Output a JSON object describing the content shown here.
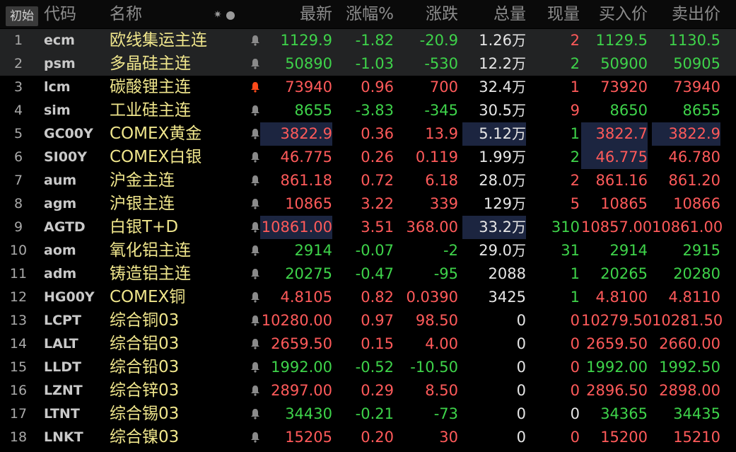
{
  "header": {
    "init_label": "初始",
    "code": "代码",
    "name": "名称",
    "last": "最新",
    "pct": "涨幅%",
    "change": "涨跌",
    "volume": "总量",
    "current": "现量",
    "bid": "买入价",
    "ask": "卖出价"
  },
  "colors": {
    "up": "#ff5a5a",
    "down": "#3ed34a",
    "name": "#f0e68c",
    "highlight": "#1c2540",
    "selected_row": "#222324"
  },
  "rows": [
    {
      "num": "1",
      "code": "ecm",
      "name": "欧线集运主连",
      "alert": false,
      "last": "1129.9",
      "pct": "-1.82",
      "chg": "-20.9",
      "vol": "1.26",
      "vol_unit": "万",
      "cur": "2",
      "bid": "1129.5",
      "ask": "1130.5",
      "dir": "dn",
      "cur_dir": "up",
      "bid_dir": "dn",
      "ask_dir": "dn"
    },
    {
      "num": "2",
      "code": "psm",
      "name": "多晶硅主连",
      "alert": false,
      "last": "50890",
      "pct": "-1.03",
      "chg": "-530",
      "vol": "12.2",
      "vol_unit": "万",
      "cur": "2",
      "bid": "50900",
      "ask": "50905",
      "dir": "dn",
      "cur_dir": "dn",
      "bid_dir": "dn",
      "ask_dir": "dn"
    },
    {
      "num": "3",
      "code": "lcm",
      "name": "碳酸锂主连",
      "alert": true,
      "last": "73940",
      "pct": "0.96",
      "chg": "700",
      "vol": "32.4",
      "vol_unit": "万",
      "cur": "1",
      "bid": "73920",
      "ask": "73940",
      "dir": "up",
      "cur_dir": "up",
      "bid_dir": "up",
      "ask_dir": "up"
    },
    {
      "num": "4",
      "code": "sim",
      "name": "工业硅主连",
      "alert": false,
      "last": "8655",
      "pct": "-3.83",
      "chg": "-345",
      "vol": "30.5",
      "vol_unit": "万",
      "cur": "9",
      "bid": "8650",
      "ask": "8655",
      "dir": "dn",
      "cur_dir": "up",
      "bid_dir": "dn",
      "ask_dir": "dn"
    },
    {
      "num": "5",
      "code": "GC00Y",
      "name": "COMEX黄金",
      "alert": false,
      "last": "3822.9",
      "pct": "0.36",
      "chg": "13.9",
      "vol": "5.12",
      "vol_unit": "万",
      "cur": "1",
      "bid": "3822.7",
      "ask": "3822.9",
      "dir": "up",
      "cur_dir": "dn",
      "bid_dir": "up",
      "ask_dir": "up"
    },
    {
      "num": "6",
      "code": "SI00Y",
      "name": "COMEX白银",
      "alert": false,
      "last": "46.775",
      "pct": "0.26",
      "chg": "0.119",
      "vol": "1.99",
      "vol_unit": "万",
      "cur": "2",
      "bid": "46.775",
      "ask": "46.780",
      "dir": "up",
      "cur_dir": "dn",
      "bid_dir": "up",
      "ask_dir": "up"
    },
    {
      "num": "7",
      "code": "aum",
      "name": "沪金主连",
      "alert": false,
      "last": "861.18",
      "pct": "0.72",
      "chg": "6.18",
      "vol": "28.0",
      "vol_unit": "万",
      "cur": "2",
      "bid": "861.16",
      "ask": "861.20",
      "dir": "up",
      "cur_dir": "up",
      "bid_dir": "up",
      "ask_dir": "up"
    },
    {
      "num": "8",
      "code": "agm",
      "name": "沪银主连",
      "alert": false,
      "last": "10865",
      "pct": "3.22",
      "chg": "339",
      "vol": "129",
      "vol_unit": "万",
      "cur": "5",
      "bid": "10865",
      "ask": "10866",
      "dir": "up",
      "cur_dir": "up",
      "bid_dir": "up",
      "ask_dir": "up"
    },
    {
      "num": "9",
      "code": "AGTD",
      "name": "白银T+D",
      "alert": false,
      "last": "10861.00",
      "pct": "3.51",
      "chg": "368.00",
      "vol": "33.2",
      "vol_unit": "万",
      "cur": "310",
      "bid": "10857.00",
      "ask": "10861.00",
      "dir": "up",
      "cur_dir": "dn",
      "bid_dir": "up",
      "ask_dir": "up"
    },
    {
      "num": "10",
      "code": "aom",
      "name": "氧化铝主连",
      "alert": false,
      "last": "2914",
      "pct": "-0.07",
      "chg": "-2",
      "vol": "29.0",
      "vol_unit": "万",
      "cur": "31",
      "bid": "2914",
      "ask": "2915",
      "dir": "dn",
      "cur_dir": "dn",
      "bid_dir": "dn",
      "ask_dir": "dn"
    },
    {
      "num": "11",
      "code": "adm",
      "name": "铸造铝主连",
      "alert": false,
      "last": "20275",
      "pct": "-0.47",
      "chg": "-95",
      "vol": "2088",
      "vol_unit": "",
      "cur": "1",
      "bid": "20265",
      "ask": "20280",
      "dir": "dn",
      "cur_dir": "dn",
      "bid_dir": "dn",
      "ask_dir": "dn"
    },
    {
      "num": "12",
      "code": "HG00Y",
      "name": "COMEX铜",
      "alert": false,
      "last": "4.8105",
      "pct": "0.82",
      "chg": "0.0390",
      "vol": "3425",
      "vol_unit": "",
      "cur": "1",
      "bid": "4.8100",
      "ask": "4.8110",
      "dir": "up",
      "cur_dir": "dn",
      "bid_dir": "up",
      "ask_dir": "up"
    },
    {
      "num": "13",
      "code": "LCPT",
      "name": "综合铜03",
      "alert": false,
      "last": "10280.00",
      "pct": "0.97",
      "chg": "98.50",
      "vol": "0",
      "vol_unit": "",
      "cur": "0",
      "bid": "10279.50",
      "ask": "10281.50",
      "dir": "up",
      "cur_dir": "up",
      "bid_dir": "up",
      "ask_dir": "up"
    },
    {
      "num": "14",
      "code": "LALT",
      "name": "综合铝03",
      "alert": false,
      "last": "2659.50",
      "pct": "0.15",
      "chg": "4.00",
      "vol": "0",
      "vol_unit": "",
      "cur": "0",
      "bid": "2659.50",
      "ask": "2660.00",
      "dir": "up",
      "cur_dir": "up",
      "bid_dir": "up",
      "ask_dir": "up"
    },
    {
      "num": "15",
      "code": "LLDT",
      "name": "综合铅03",
      "alert": false,
      "last": "1992.00",
      "pct": "-0.52",
      "chg": "-10.50",
      "vol": "0",
      "vol_unit": "",
      "cur": "0",
      "bid": "1992.00",
      "ask": "1992.50",
      "dir": "dn",
      "cur_dir": "up",
      "bid_dir": "dn",
      "ask_dir": "dn"
    },
    {
      "num": "16",
      "code": "LZNT",
      "name": "综合锌03",
      "alert": false,
      "last": "2897.00",
      "pct": "0.29",
      "chg": "8.50",
      "vol": "0",
      "vol_unit": "",
      "cur": "0",
      "bid": "2896.50",
      "ask": "2898.00",
      "dir": "up",
      "cur_dir": "up",
      "bid_dir": "up",
      "ask_dir": "up"
    },
    {
      "num": "17",
      "code": "LTNT",
      "name": "综合锡03",
      "alert": false,
      "last": "34430",
      "pct": "-0.21",
      "chg": "-73",
      "vol": "0",
      "vol_unit": "",
      "cur": "0",
      "bid": "34365",
      "ask": "34435",
      "dir": "dn",
      "cur_dir": "fl",
      "bid_dir": "dn",
      "ask_dir": "dn"
    },
    {
      "num": "18",
      "code": "LNKT",
      "name": "综合镍03",
      "alert": false,
      "last": "15205",
      "pct": "0.20",
      "chg": "30",
      "vol": "0",
      "vol_unit": "",
      "cur": "0",
      "bid": "15200",
      "ask": "15210",
      "dir": "up",
      "cur_dir": "up",
      "bid_dir": "up",
      "ask_dir": "up"
    }
  ]
}
